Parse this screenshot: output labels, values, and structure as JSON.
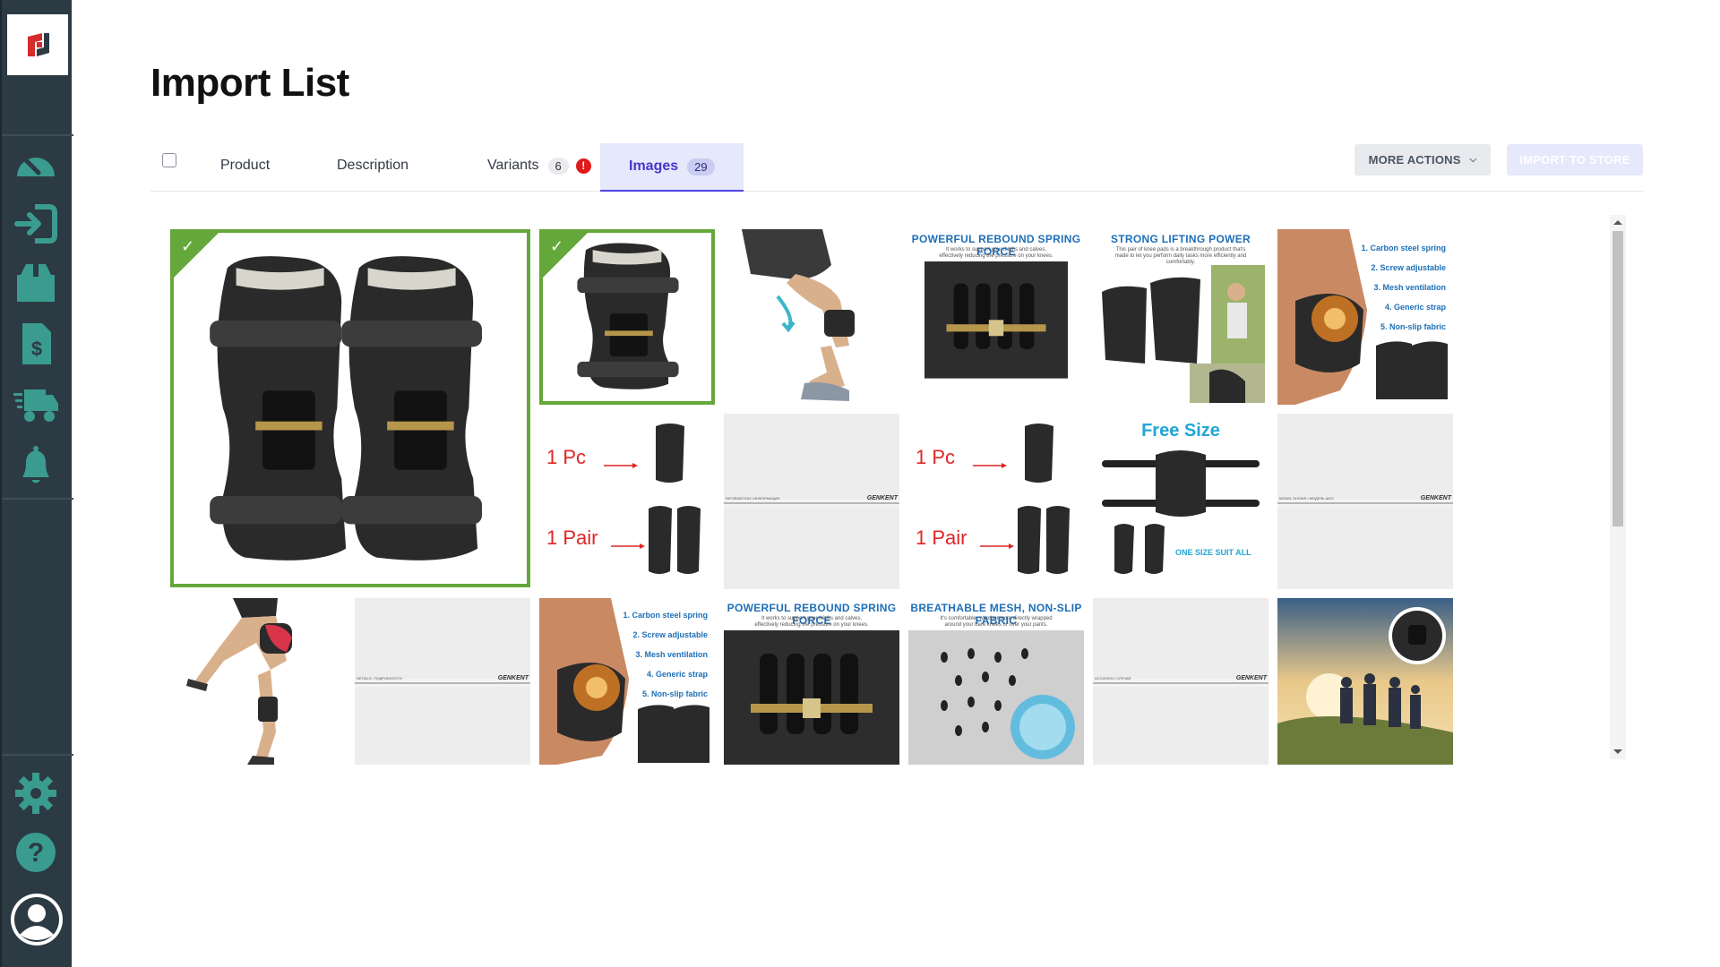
{
  "page": {
    "title": "Import List"
  },
  "sidebar": {
    "items": [
      {
        "name": "dashboard-icon"
      },
      {
        "name": "import-icon"
      },
      {
        "name": "products-box-icon"
      },
      {
        "name": "orders-dollar-icon"
      },
      {
        "name": "shipping-truck-icon"
      },
      {
        "name": "notifications-bell-icon"
      },
      {
        "name": "settings-gear-icon"
      },
      {
        "name": "help-question-icon"
      },
      {
        "name": "user-avatar-icon"
      }
    ],
    "colors": {
      "bg": "#2c3a44",
      "icon": "#3a9b8f"
    }
  },
  "tabs": {
    "product": "Product",
    "description": "Description",
    "variants": "Variants",
    "variants_count": "6",
    "variants_alert": "!",
    "images": "Images",
    "images_count": "29"
  },
  "actions": {
    "more": "MORE ACTIONS",
    "import": "IMPORT TO STORE"
  },
  "images": {
    "selected_color": "#64a73a",
    "accent": "#4f46e5",
    "labels": {
      "powerful": "POWERFUL REBOUND SPRING FORCE",
      "powerful_sub": "It works to support your thighs and calves, effectively reducing the pressure on your knees.",
      "strong": "STRONG LIFTING POWER",
      "strong_sub": "This pair of knee pads is a breakthrough product that's made to let you perform daily tasks more efficiently and comfortably.",
      "breathable": "BREATHABLE MESH, NON-SLIP FABRIC",
      "breathable_sub": "It's comfortable, whether worn directly wrapped around your bare knees or over your pants.",
      "one_pc": "1 Pc",
      "one_pair": "1 Pair",
      "free_size": "Free Size",
      "one_size": "ONE SIZE SUIT ALL",
      "features": [
        "1. Carbon steel spring",
        "2. Screw adjustable",
        "3. Mesh ventilation",
        "4. Generic strap",
        "5. Non-slip fabric"
      ],
      "brand": "GENKENT",
      "sheet1": "INFORMATION / ИНФОРМАЦИЯ",
      "sheet2": "MODEL SHOWS / МОДЕЛЬ ШОУ",
      "sheet3": "DETAILS / ПОДРОБНОСТИ",
      "sheet4": "ACCASION / СЛУЧАЙ"
    }
  }
}
